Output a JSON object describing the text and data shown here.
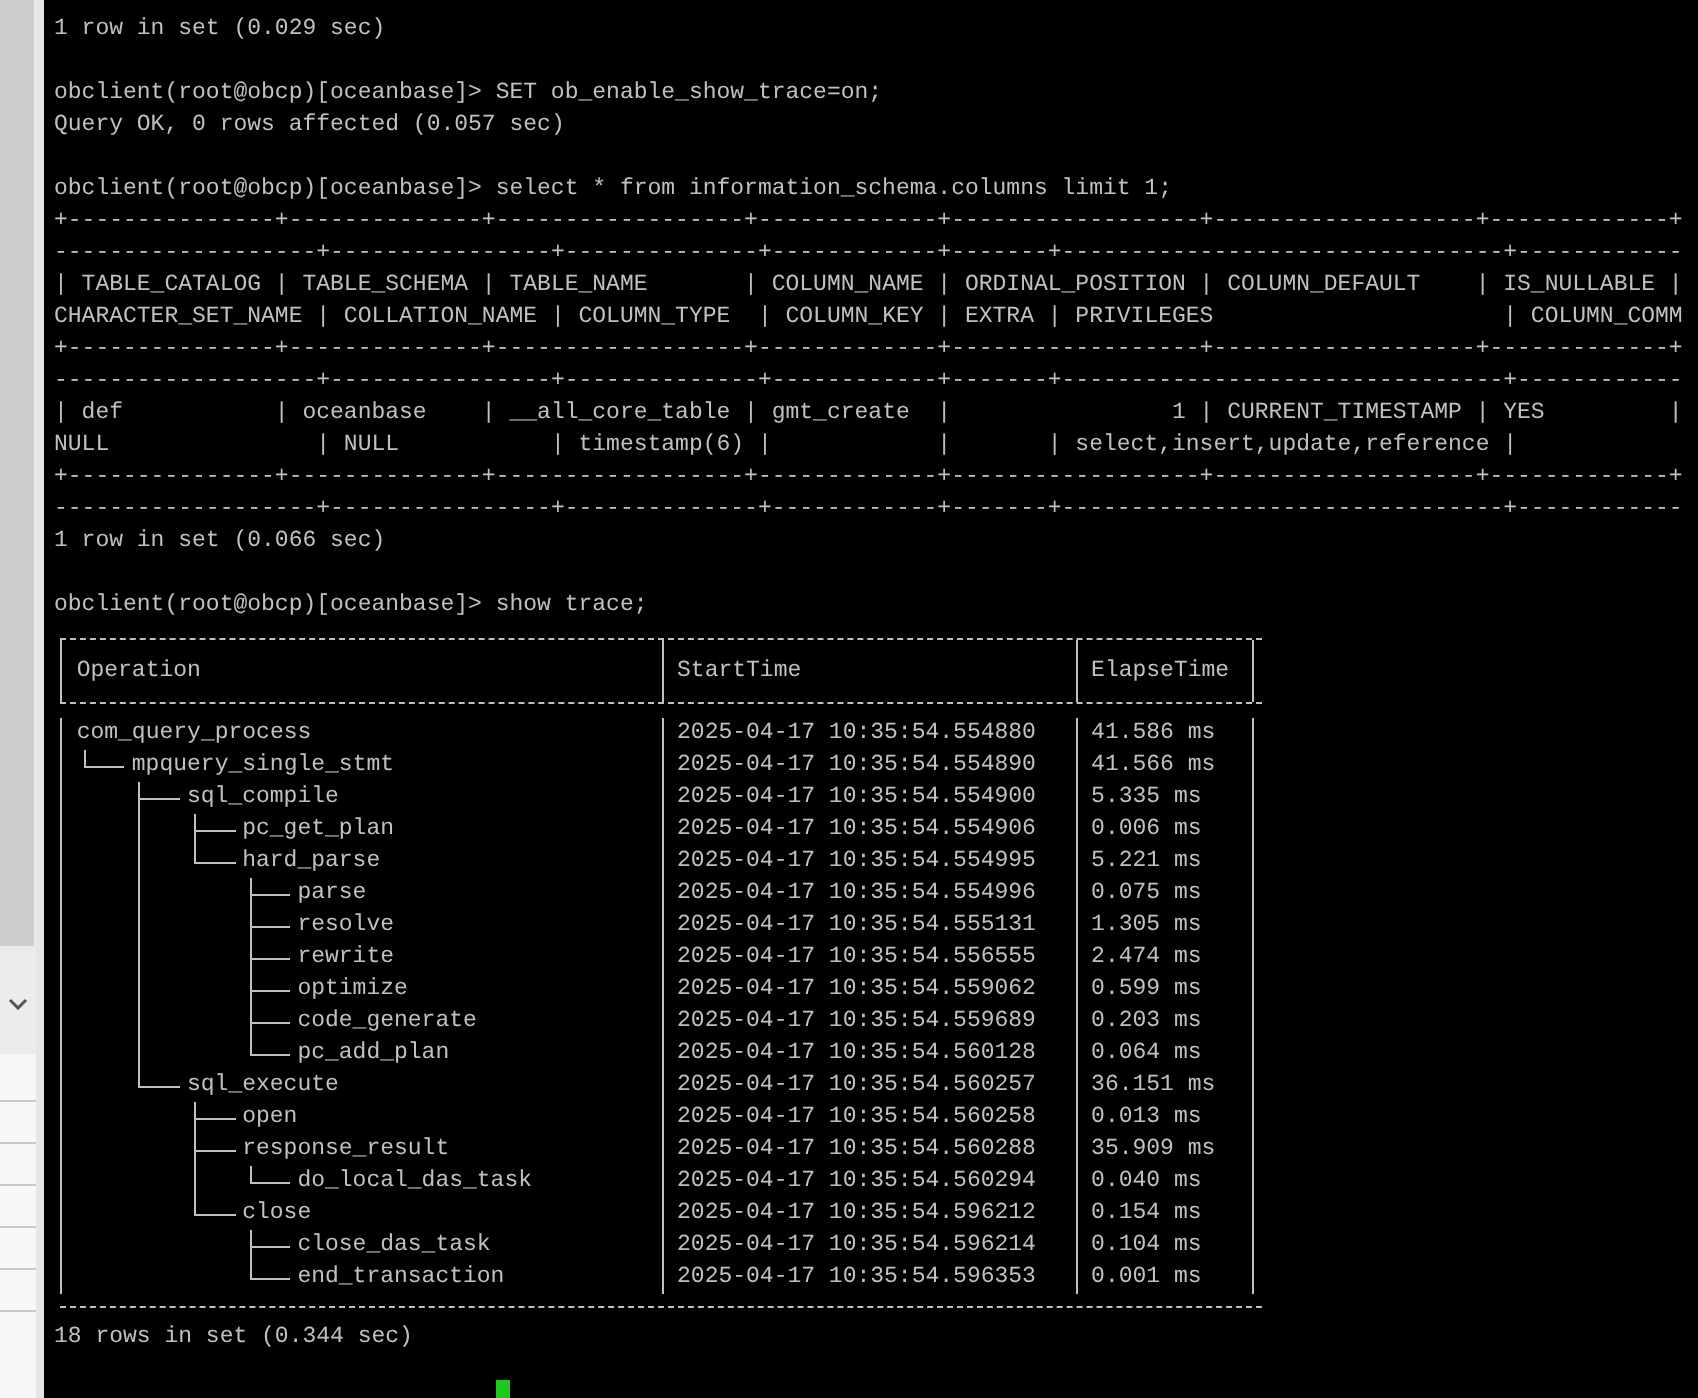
{
  "terminal": {
    "lines_before": [
      {
        "kind": "output",
        "text": "1 row in set (0.029 sec)"
      },
      {
        "kind": "blank"
      },
      {
        "kind": "prompt",
        "prompt": "obclient(root@obcp)[oceanbase]>",
        "command": "SET ob_enable_show_trace=on;"
      },
      {
        "kind": "output",
        "text": "Query OK, 0 rows affected (0.057 sec)"
      },
      {
        "kind": "blank"
      },
      {
        "kind": "prompt",
        "prompt": "obclient(root@obcp)[oceanbase]>",
        "command": "select * from information_schema.columns limit 1;"
      },
      {
        "kind": "output",
        "text": "+---------------+--------------+------------------+-------------+------------------+-------------------+-------------+"
      },
      {
        "kind": "output",
        "text": "-------------------+----------------+--------------+------------+-------+--------------------------------+------------"
      },
      {
        "kind": "output",
        "text": "| TABLE_CATALOG | TABLE_SCHEMA | TABLE_NAME       | COLUMN_NAME | ORDINAL_POSITION | COLUMN_DEFAULT    | IS_NULLABLE |"
      },
      {
        "kind": "output",
        "text": "CHARACTER_SET_NAME | COLLATION_NAME | COLUMN_TYPE  | COLUMN_KEY | EXTRA | PRIVILEGES                     | COLUMN_COMM"
      },
      {
        "kind": "output",
        "text": "+---------------+--------------+------------------+-------------+------------------+-------------------+-------------+"
      },
      {
        "kind": "output",
        "text": "-------------------+----------------+--------------+------------+-------+--------------------------------+------------"
      },
      {
        "kind": "output",
        "text": "| def           | oceanbase    | __all_core_table | gmt_create  |                1 | CURRENT_TIMESTAMP | YES         |"
      },
      {
        "kind": "output",
        "text": "NULL               | NULL           | timestamp(6) |            |       | select,insert,update,reference |"
      },
      {
        "kind": "output",
        "text": "+---------------+--------------+------------------+-------------+------------------+-------------------+-------------+"
      },
      {
        "kind": "output",
        "text": "-------------------+----------------+--------------+------------+-------+--------------------------------+------------"
      },
      {
        "kind": "output",
        "text": "1 row in set (0.066 sec)"
      },
      {
        "kind": "blank"
      },
      {
        "kind": "prompt",
        "prompt": "obclient(root@obcp)[oceanbase]>",
        "command": "show trace;"
      }
    ],
    "trace": {
      "columns": [
        "Operation",
        "StartTime",
        "ElapseTime"
      ],
      "rows": [
        {
          "operation": "com_query_process",
          "start_time": "2025-04-17 10:35:54.554880",
          "elapse_time": "41.586 ms",
          "children": [
            {
              "operation": "mpquery_single_stmt",
              "start_time": "2025-04-17 10:35:54.554890",
              "elapse_time": "41.566 ms",
              "children": [
                {
                  "operation": "sql_compile",
                  "start_time": "2025-04-17 10:35:54.554900",
                  "elapse_time": "5.335 ms",
                  "children": [
                    {
                      "operation": "pc_get_plan",
                      "start_time": "2025-04-17 10:35:54.554906",
                      "elapse_time": "0.006 ms"
                    },
                    {
                      "operation": "hard_parse",
                      "start_time": "2025-04-17 10:35:54.554995",
                      "elapse_time": "5.221 ms",
                      "children": [
                        {
                          "operation": "parse",
                          "start_time": "2025-04-17 10:35:54.554996",
                          "elapse_time": "0.075 ms"
                        },
                        {
                          "operation": "resolve",
                          "start_time": "2025-04-17 10:35:54.555131",
                          "elapse_time": "1.305 ms"
                        },
                        {
                          "operation": "rewrite",
                          "start_time": "2025-04-17 10:35:54.556555",
                          "elapse_time": "2.474 ms"
                        },
                        {
                          "operation": "optimize",
                          "start_time": "2025-04-17 10:35:54.559062",
                          "elapse_time": "0.599 ms"
                        },
                        {
                          "operation": "code_generate",
                          "start_time": "2025-04-17 10:35:54.559689",
                          "elapse_time": "0.203 ms"
                        },
                        {
                          "operation": "pc_add_plan",
                          "start_time": "2025-04-17 10:35:54.560128",
                          "elapse_time": "0.064 ms"
                        }
                      ]
                    }
                  ]
                },
                {
                  "operation": "sql_execute",
                  "start_time": "2025-04-17 10:35:54.560257",
                  "elapse_time": "36.151 ms",
                  "children": [
                    {
                      "operation": "open",
                      "start_time": "2025-04-17 10:35:54.560258",
                      "elapse_time": "0.013 ms"
                    },
                    {
                      "operation": "response_result",
                      "start_time": "2025-04-17 10:35:54.560288",
                      "elapse_time": "35.909 ms",
                      "children": [
                        {
                          "operation": "do_local_das_task",
                          "start_time": "2025-04-17 10:35:54.560294",
                          "elapse_time": "0.040 ms"
                        }
                      ]
                    },
                    {
                      "operation": "close",
                      "start_time": "2025-04-17 10:35:54.596212",
                      "elapse_time": "0.154 ms",
                      "children": [
                        {
                          "operation": "close_das_task",
                          "start_time": "2025-04-17 10:35:54.596214",
                          "elapse_time": "0.104 ms"
                        },
                        {
                          "operation": "end_transaction",
                          "start_time": "2025-04-17 10:35:54.596353",
                          "elapse_time": "0.001 ms"
                        }
                      ]
                    }
                  ]
                }
              ]
            }
          ]
        }
      ]
    },
    "lines_after": [
      {
        "kind": "output",
        "text": "18 rows in set (0.344 sec)"
      },
      {
        "kind": "blank"
      }
    ],
    "input_cursor": true
  }
}
